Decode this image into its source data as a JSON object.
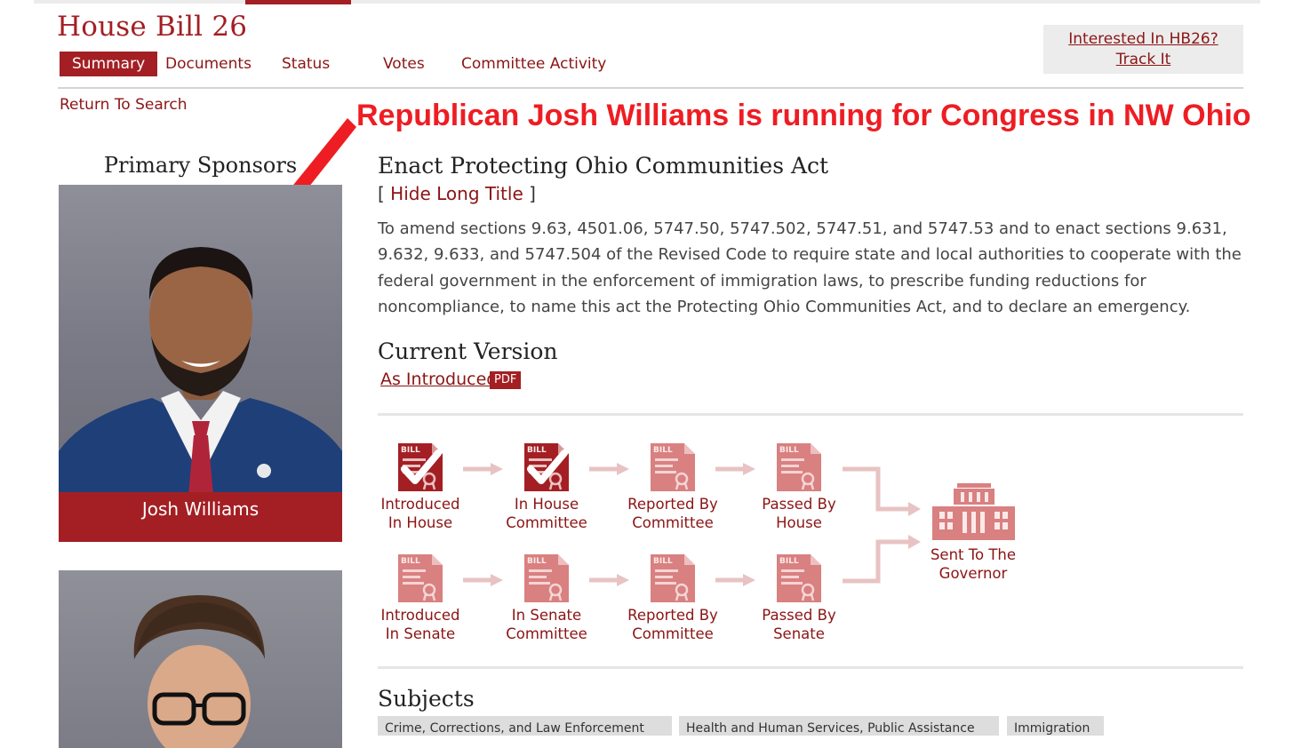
{
  "header": {
    "bill_title": "House Bill 26",
    "tabs": [
      {
        "label": "Summary",
        "active": true
      },
      {
        "label": "Documents"
      },
      {
        "label": "Status"
      },
      {
        "label": "Votes"
      },
      {
        "label": "Committee Activity"
      }
    ],
    "track": {
      "line1": "Interested In HB26?",
      "line2": "Track It"
    }
  },
  "return_link": "Return To Search",
  "annotation": {
    "text": "Republican Josh Williams is running for Congress in NW Ohio",
    "color": "#ee1d23"
  },
  "sponsors": {
    "heading": "Primary Sponsors",
    "people": [
      {
        "name": "Josh Williams"
      },
      {
        "name": ""
      }
    ]
  },
  "main": {
    "act_title": "Enact Protecting Ohio Communities Act",
    "bracket_open": "[",
    "hide_long_title": "Hide Long Title",
    "bracket_close": "]",
    "long_title": "To amend sections 9.63, 4501.06, 5747.50, 5747.502, 5747.51, and 5747.53 and to enact sections 9.631, 9.632, 9.633, and 5747.504 of the Revised Code to require state and local authorities to cooperate with the federal government in the enforcement of immigration laws, to prescribe funding reductions for noncompliance, to name this act the Protecting Ohio Communities Act, and to declare an emergency.",
    "current_version_heading": "Current Version",
    "version_link": "As Introduced",
    "pdf_badge": "PDF",
    "status_steps": [
      {
        "line1": "Introduced",
        "line2": "In House",
        "completed": true
      },
      {
        "line1": "In House",
        "line2": "Committee",
        "completed": true
      },
      {
        "line1": "Reported By",
        "line2": "Committee",
        "completed": false
      },
      {
        "line1": "Passed By",
        "line2": "House",
        "completed": false
      },
      {
        "line1": "Introduced",
        "line2": "In Senate",
        "completed": false
      },
      {
        "line1": "In Senate",
        "line2": "Committee",
        "completed": false
      },
      {
        "line1": "Reported By",
        "line2": "Committee",
        "completed": false
      },
      {
        "line1": "Passed By",
        "line2": "Senate",
        "completed": false
      },
      {
        "line1": "Sent To The",
        "line2": "Governor",
        "completed": false
      }
    ],
    "icon_word": "BILL",
    "subjects_heading": "Subjects",
    "subjects": [
      "Crime, Corrections, and Law Enforcement",
      "Health and Human Services, Public Assistance",
      "Immigration"
    ]
  },
  "colors": {
    "brand": "#a31f24",
    "link": "#8c1515",
    "faded_icon": "#d98080",
    "arrow_faded": "#e8c3c3"
  }
}
